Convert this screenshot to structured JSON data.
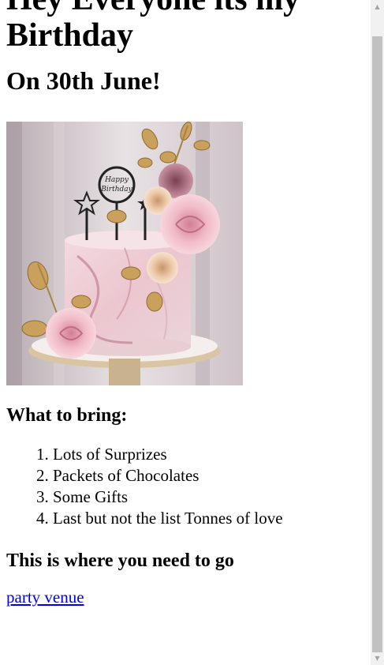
{
  "heading_main": "Hey Everyone its my Birthday",
  "heading_date": "On 30th June!",
  "image": {
    "alt": "Birthday cake with pink and gold roses and a Happy Birthday topper",
    "topper_text_1": "Happy",
    "topper_text_2": "Birthday"
  },
  "bring_heading": "What to bring:",
  "bring_items": [
    "Lots of Surprizes",
    "Packets of Chocolates",
    "Some Gifts",
    "Last but not the list Tonnes of love"
  ],
  "venue_heading": "This is where you need to go",
  "venue_link_text": "party venue",
  "colors": {
    "link": "#0000ee",
    "scrollbar_track": "#f1f1f1",
    "scrollbar_thumb": "#c1c1c1"
  }
}
